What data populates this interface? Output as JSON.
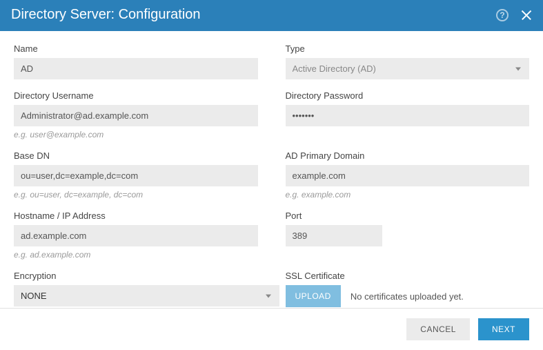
{
  "header": {
    "title": "Directory Server: Configuration"
  },
  "fields": {
    "name": {
      "label": "Name",
      "value": "AD"
    },
    "type": {
      "label": "Type",
      "value": "Active Directory (AD)"
    },
    "username": {
      "label": "Directory Username",
      "value": "Administrator@ad.example.com",
      "hint": "e.g. user@example.com"
    },
    "password": {
      "label": "Directory Password",
      "value": "•••••••"
    },
    "basedn": {
      "label": "Base DN",
      "value": "ou=user,dc=example,dc=com",
      "hint": "e.g. ou=user, dc=example, dc=com"
    },
    "primary_domain": {
      "label": "AD Primary Domain",
      "value": "example.com",
      "hint": "e.g. example.com"
    },
    "hostname": {
      "label": "Hostname / IP Address",
      "value": "ad.example.com",
      "hint": "e.g. ad.example.com"
    },
    "port": {
      "label": "Port",
      "value": "389"
    },
    "encryption": {
      "label": "Encryption",
      "value": "NONE"
    },
    "ssl": {
      "label": "SSL Certificate",
      "upload_label": "UPLOAD",
      "status": "No certificates uploaded yet."
    }
  },
  "footer": {
    "cancel": "CANCEL",
    "next": "NEXT"
  }
}
